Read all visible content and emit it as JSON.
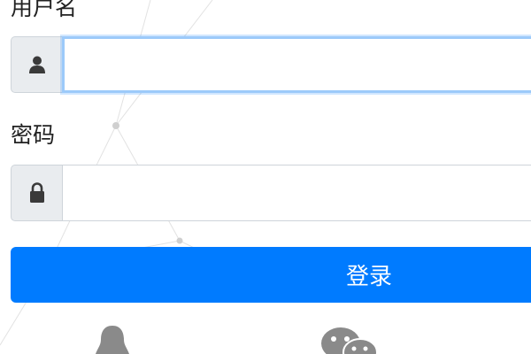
{
  "form": {
    "username_label": "用户名",
    "username_value": "",
    "password_label": "密码",
    "password_value": "",
    "login_label": "登录"
  },
  "icons": {
    "username_addon": "user-icon",
    "password_addon": "lock-icon",
    "social": [
      "qq-icon",
      "wechat-icon"
    ]
  },
  "colors": {
    "primary": "#007bff",
    "addon_bg": "#e9ecef",
    "icon": "#3a3a3a",
    "social_icon": "#8a8a8a",
    "focus_border": "#9ccafa"
  }
}
